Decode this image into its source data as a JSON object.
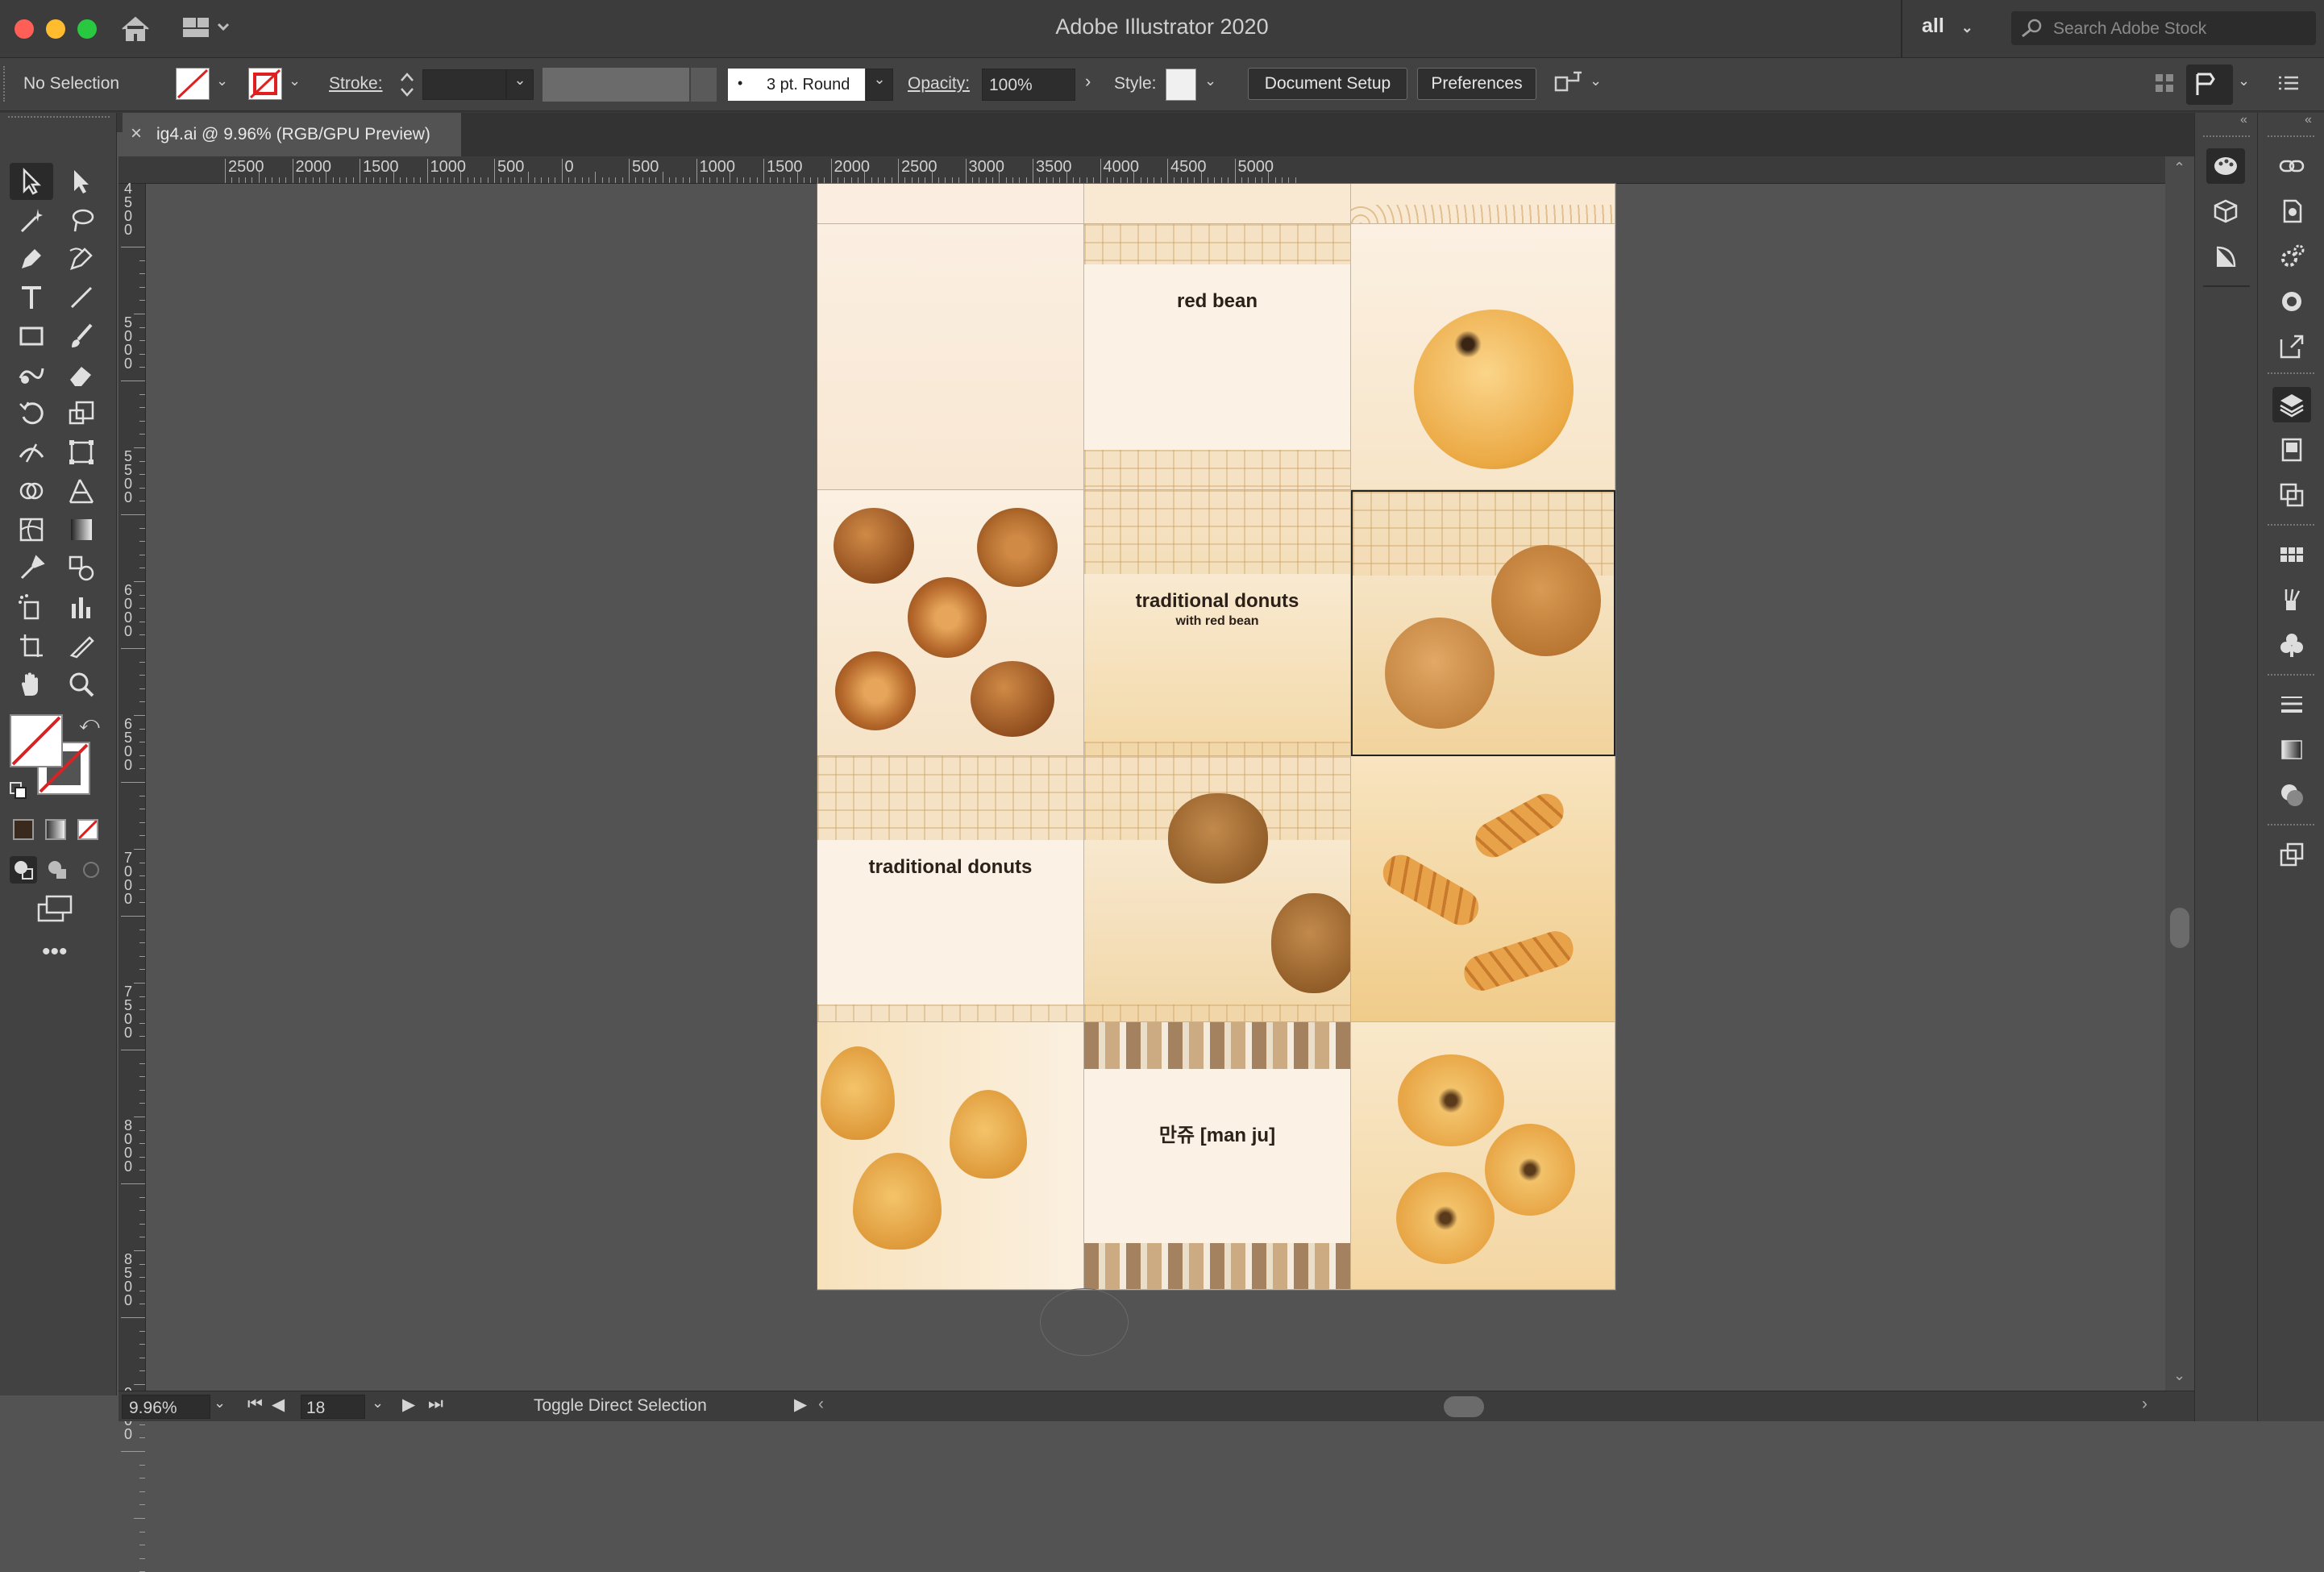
{
  "window": {
    "title": "Adobe Illustrator 2020",
    "workspace": "all",
    "search_placeholder": "Search Adobe Stock"
  },
  "control_bar": {
    "selection": "No Selection",
    "stroke_label": "Stroke:",
    "brush": "3 pt. Round",
    "opacity_label": "Opacity:",
    "opacity_value": "100%",
    "style_label": "Style:",
    "document_setup": "Document Setup",
    "preferences": "Preferences"
  },
  "document_tab": {
    "close_glyph": "×",
    "title": "ig4.ai @ 9.96% (RGB/GPU Preview)"
  },
  "ruler": {
    "horizontal": [
      "2500",
      "2000",
      "1500",
      "1000",
      "500",
      "0",
      "500",
      "1000",
      "1500",
      "2000",
      "2500",
      "3000",
      "3500",
      "4000",
      "4500",
      "5000"
    ],
    "vertical": [
      "4500",
      "5000",
      "5500",
      "6000",
      "6500",
      "7000",
      "7500",
      "8000",
      "8500",
      "9000"
    ]
  },
  "artboard": {
    "labels": {
      "red_bean": "red bean",
      "traditional_donuts_red_bean": "traditional donuts",
      "with_red_bean": "with red bean",
      "traditional_donuts": "traditional donuts",
      "manju": "만쥬 [man ju]"
    }
  },
  "status": {
    "zoom": "9.96%",
    "artboard_number": "18",
    "hint": "Toggle Direct Selection"
  },
  "colors": {
    "chrome_dark": "#3c3c3c",
    "panel": "#424242",
    "canvas": "#535353",
    "artboard_bg": "#f7e7cc",
    "accent_red": "#e02020"
  }
}
